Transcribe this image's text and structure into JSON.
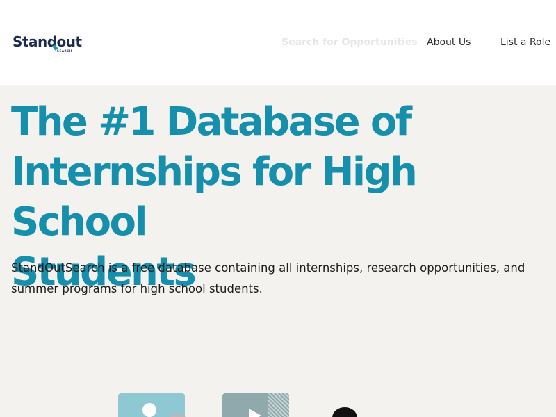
{
  "header": {
    "logo": {
      "wordmark": "Standout",
      "sub": "SEARCH"
    },
    "nav": [
      {
        "label": "Search for Opportunities"
      },
      {
        "label": "About Us"
      },
      {
        "label": "List a Role"
      }
    ]
  },
  "hero": {
    "title_lines": [
      "The #1 Database of",
      "Internships for High School",
      "Students"
    ],
    "description": "StandOutSearch is a free database containing all internships, research opportunities, and summer programs for high school students."
  },
  "illustrations": [
    {
      "icon": "user-image-icon"
    },
    {
      "icon": "play-icon"
    },
    {
      "icon": "person-silhouette-icon"
    }
  ],
  "colors": {
    "brand_navy": "#1d2a52",
    "accent_teal": "#168fac",
    "page_bg": "#f3f2ef",
    "header_bg": "#ffffff"
  }
}
